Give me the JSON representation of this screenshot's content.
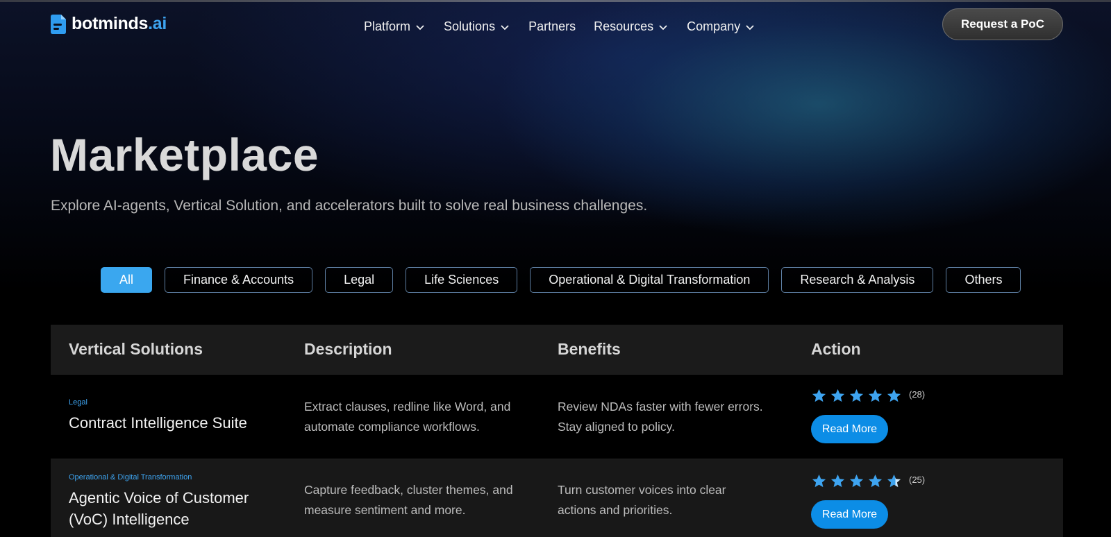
{
  "brand": {
    "name": "botminds",
    "tld": ".ai",
    "accent": "#3ea4f0"
  },
  "nav": {
    "items": [
      {
        "label": "Platform",
        "dropdown": true
      },
      {
        "label": "Solutions",
        "dropdown": true
      },
      {
        "label": "Partners",
        "dropdown": false
      },
      {
        "label": "Resources",
        "dropdown": true
      },
      {
        "label": "Company",
        "dropdown": true
      }
    ],
    "cta": "Request a PoC"
  },
  "hero": {
    "title": "Marketplace",
    "subtitle": "Explore AI-agents, Vertical Solution, and accelerators built to solve real business challenges."
  },
  "filters": [
    {
      "label": "All",
      "active": true
    },
    {
      "label": "Finance & Accounts",
      "active": false
    },
    {
      "label": "Legal",
      "active": false
    },
    {
      "label": "Life Sciences",
      "active": false
    },
    {
      "label": "Operational & Digital Transformation",
      "active": false
    },
    {
      "label": "Research & Analysis",
      "active": false
    },
    {
      "label": "Others",
      "active": false
    }
  ],
  "table": {
    "headers": [
      "Vertical Solutions",
      "Description",
      "Benefits",
      "Action"
    ],
    "rows": [
      {
        "tag": "Legal",
        "name": "Contract Intelligence Suite",
        "description": "Extract clauses, redline like Word, and automate compliance workflows.",
        "benefits": "Review NDAs faster with fewer errors. Stay aligned to policy.",
        "rating": 5,
        "reviews": "(28)",
        "action": "Read More"
      },
      {
        "tag": "Operational & Digital Transformation",
        "name": "Agentic Voice of Customer (VoC) Intelligence",
        "description": "Capture feedback, cluster themes, and measure sentiment and more.",
        "benefits": "Turn customer voices into clear actions and priorities.",
        "rating": 4.5,
        "reviews": "(25)",
        "action": "Read More"
      }
    ]
  },
  "colors": {
    "star": "#3ea4f0",
    "button": "#0c8de6",
    "chip_active": "#3aa7ef"
  }
}
